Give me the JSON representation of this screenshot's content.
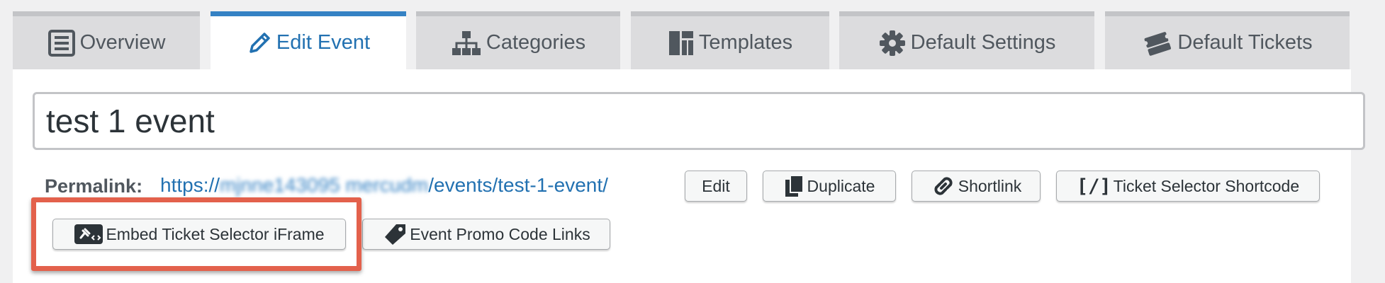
{
  "tabs": [
    {
      "label": "Overview",
      "icon": "list-icon",
      "active": false
    },
    {
      "label": "Edit Event",
      "icon": "pencil-icon",
      "active": true
    },
    {
      "label": "Categories",
      "icon": "sitemap-icon",
      "active": false
    },
    {
      "label": "Templates",
      "icon": "layout-icon",
      "active": false
    },
    {
      "label": "Default Settings",
      "icon": "gear-icon",
      "active": false
    },
    {
      "label": "Default Tickets",
      "icon": "tickets-icon",
      "active": false
    }
  ],
  "event": {
    "title": "test 1 event"
  },
  "permalink": {
    "label": "Permalink:",
    "url_prefix": "https://",
    "url_obscured": "mjnne143095 mercudm",
    "url_suffix": "/events/test-1-event/"
  },
  "buttons": {
    "edit": "Edit",
    "duplicate": "Duplicate",
    "shortlink": "Shortlink",
    "ticket_selector_shortcode": "Ticket Selector Shortcode",
    "embed_iframe": "Embed Ticket Selector iFrame",
    "promo_code_links": "Event Promo Code Links"
  },
  "icons": {
    "duplicate": "copy-icon",
    "shortlink": "link-icon",
    "shortcode": "shortcode-icon",
    "embed": "embed-icon",
    "promo": "tag-icon"
  },
  "colors": {
    "accent": "#2271b1",
    "active_tab_border": "#3582c4",
    "highlight": "#e3614c"
  }
}
